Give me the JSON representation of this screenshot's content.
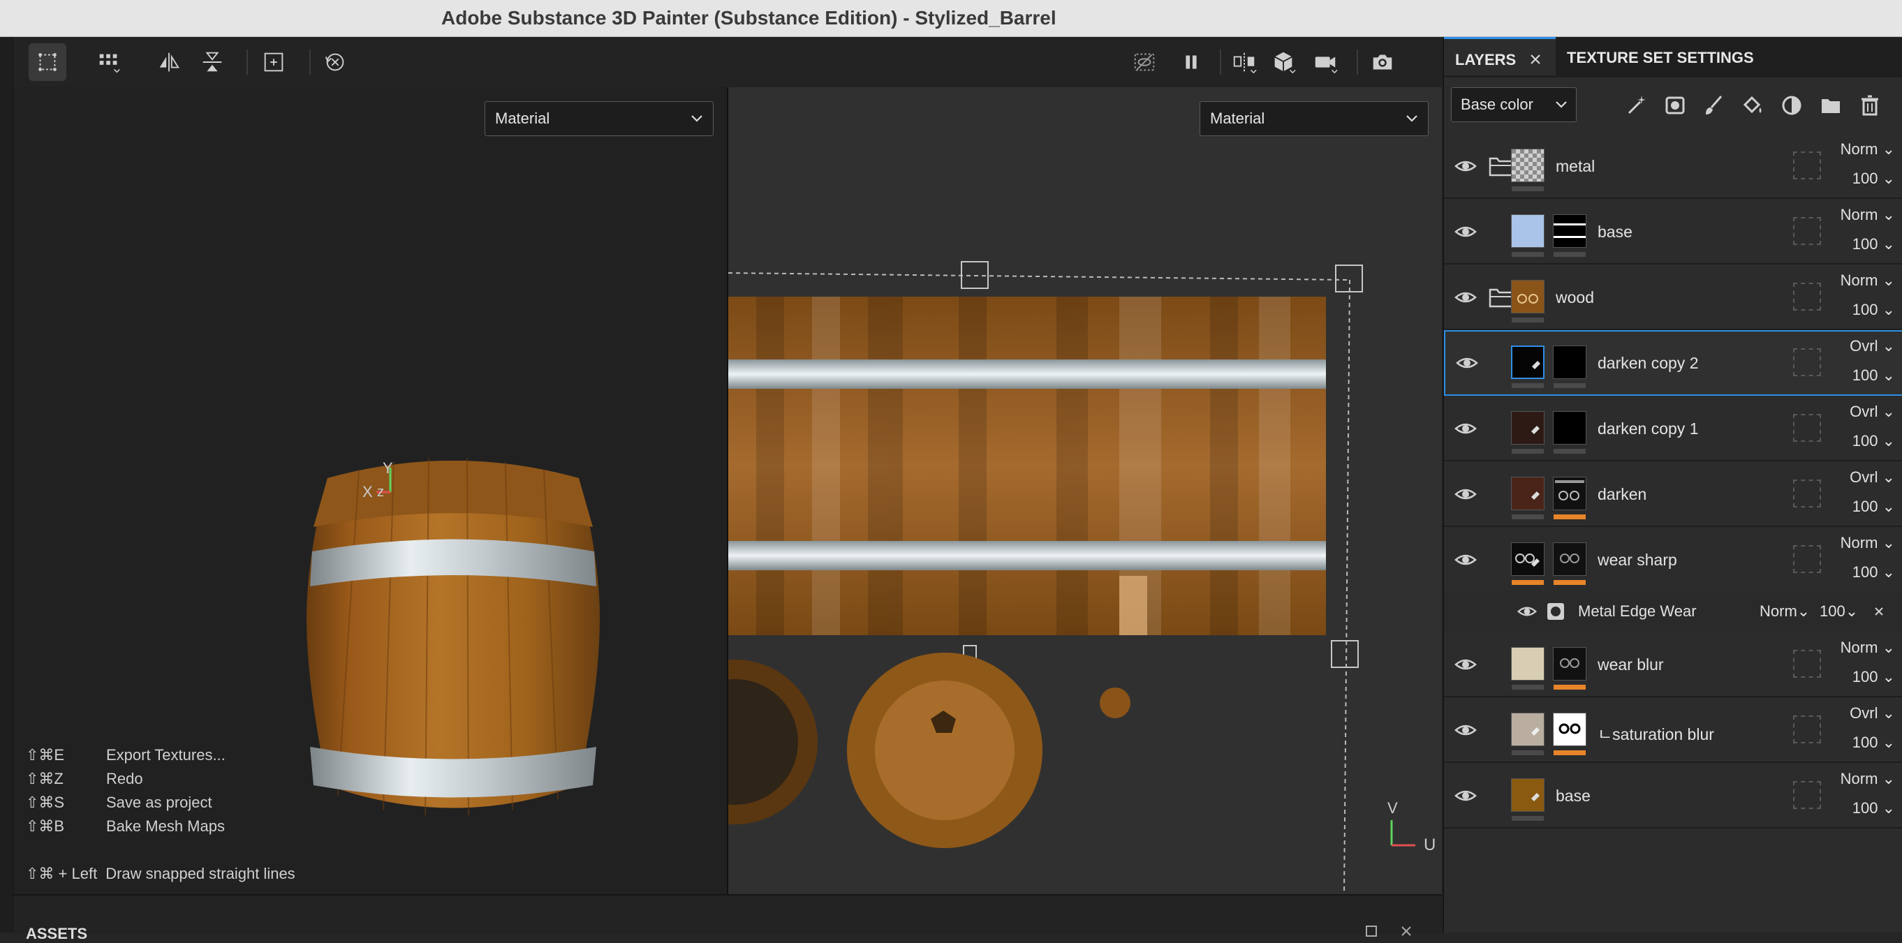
{
  "window": {
    "title": "Adobe Substance 3D Painter (Substance Edition) - Stylized_Barrel"
  },
  "viewport_toolbar": {
    "left_tools": [
      "select-tool-icon",
      "grid-icon",
      "mirror-icon",
      "split-icon",
      "fit-icon",
      "reset-rotation-icon"
    ],
    "right_tools": [
      "hide-icon",
      "pause-icon",
      "symmetry-icon",
      "cube-icon",
      "camera-icon",
      "screenshot-icon"
    ]
  },
  "viewport_3d": {
    "mode_dropdown": "Material",
    "axis_labels": {
      "x": "X",
      "y": "Y",
      "z": "z"
    },
    "shortcuts": [
      {
        "keys": "⇧⌘E",
        "label": "Export Textures..."
      },
      {
        "keys": "⇧⌘Z",
        "label": "Redo"
      },
      {
        "keys": "⇧⌘S",
        "label": "Save as project"
      },
      {
        "keys": "⇧⌘B",
        "label": "Bake Mesh Maps"
      }
    ],
    "hint": {
      "keys": "⇧⌘ + Left",
      "label": "Draw snapped straight lines"
    }
  },
  "viewport_2d": {
    "mode_dropdown": "Material",
    "axis_labels": {
      "v": "V",
      "u": "U"
    }
  },
  "assets_bar": {
    "title": "ASSETS"
  },
  "panel": {
    "tabs": [
      {
        "label": "LAYERS",
        "active": true
      },
      {
        "label": "TEXTURE SET SETTINGS",
        "active": false
      }
    ],
    "channel_dropdown": "Base color",
    "tools": [
      "magic-wand-icon",
      "smart-mask-icon",
      "paint-layer-icon",
      "fill-layer-icon",
      "mask-icon",
      "folder-icon",
      "trash-icon"
    ],
    "layers": [
      {
        "name": "metal",
        "blend": "Norm",
        "opacity": "100",
        "type": "folder",
        "selected": false
      },
      {
        "name": "base",
        "blend": "Norm",
        "opacity": "100",
        "type": "fill",
        "selected": false
      },
      {
        "name": "wood",
        "blend": "Norm",
        "opacity": "100",
        "type": "folder",
        "selected": false
      },
      {
        "name": "darken copy 2",
        "blend": "Ovrl",
        "opacity": "100",
        "type": "paint",
        "selected": true
      },
      {
        "name": "darken copy 1",
        "blend": "Ovrl",
        "opacity": "100",
        "type": "paint",
        "selected": false
      },
      {
        "name": "darken",
        "blend": "Ovrl",
        "opacity": "100",
        "type": "paint",
        "selected": false
      },
      {
        "name": "wear sharp",
        "blend": "Norm",
        "opacity": "100",
        "type": "paint",
        "selected": false
      },
      {
        "name": "wear blur",
        "blend": "Norm",
        "opacity": "100",
        "type": "paint",
        "selected": false
      },
      {
        "name": "ㄴsaturation blur",
        "blend": "Ovrl",
        "opacity": "100",
        "type": "paint",
        "selected": false
      },
      {
        "name": "base",
        "blend": "Norm",
        "opacity": "100",
        "type": "paint",
        "selected": false
      }
    ],
    "effect": {
      "name": "Metal Edge Wear",
      "blend": "Norm",
      "opacity": "100"
    }
  },
  "colors": {
    "accent": "#2f8fe6",
    "mask_bar": "#e8852a",
    "wood": "#a8671f",
    "metal_band": "#c9d2d6"
  }
}
